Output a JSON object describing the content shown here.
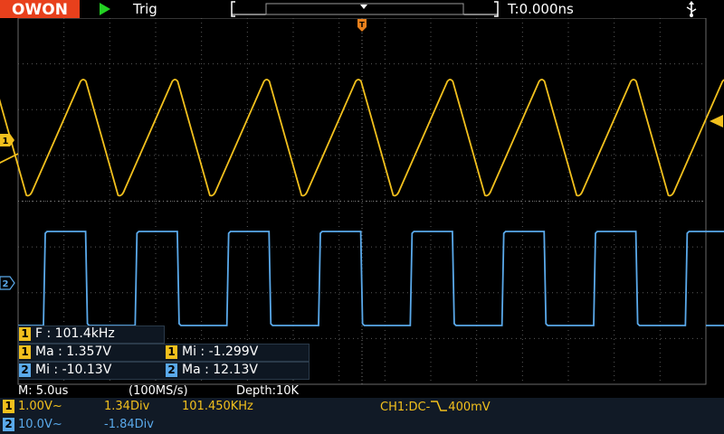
{
  "header": {
    "brand": "OWON",
    "trigger_status": "Trig",
    "trigger_time": "T:0.000ns",
    "trigger_marker": "T"
  },
  "channels": {
    "ch1": {
      "marker": "1",
      "color": "#f2c01d"
    },
    "ch2": {
      "marker": "2",
      "color": "#5aa9ea"
    }
  },
  "measurements": {
    "frequency": {
      "channel": "1",
      "text": "F : 101.4kHz"
    },
    "ch1_max": {
      "channel": "1",
      "text": "Ma : 1.357V"
    },
    "ch1_min": {
      "channel": "1",
      "text": "Mi : -1.299V"
    },
    "ch2_min": {
      "channel": "2",
      "text": "Mi : -10.13V"
    },
    "ch2_max": {
      "channel": "2",
      "text": "Ma : 12.13V"
    }
  },
  "status": {
    "timebase": "M: 5.0us",
    "sample_rate": "(100MS/s)",
    "depth": "Depth:10K"
  },
  "bottom_bar": {
    "ch1": {
      "badge": "1",
      "scale": "1.00V~",
      "position": "1.34Div",
      "frequency": "101.450KHz"
    },
    "ch2": {
      "badge": "2",
      "scale": "10.0V~",
      "position": "-1.84Div"
    },
    "trigger": {
      "source": "CH1:DC-",
      "level": "400mV"
    }
  },
  "waveforms": {
    "ch1_shape": "triangle",
    "ch2_shape": "square",
    "period_div": 2
  }
}
